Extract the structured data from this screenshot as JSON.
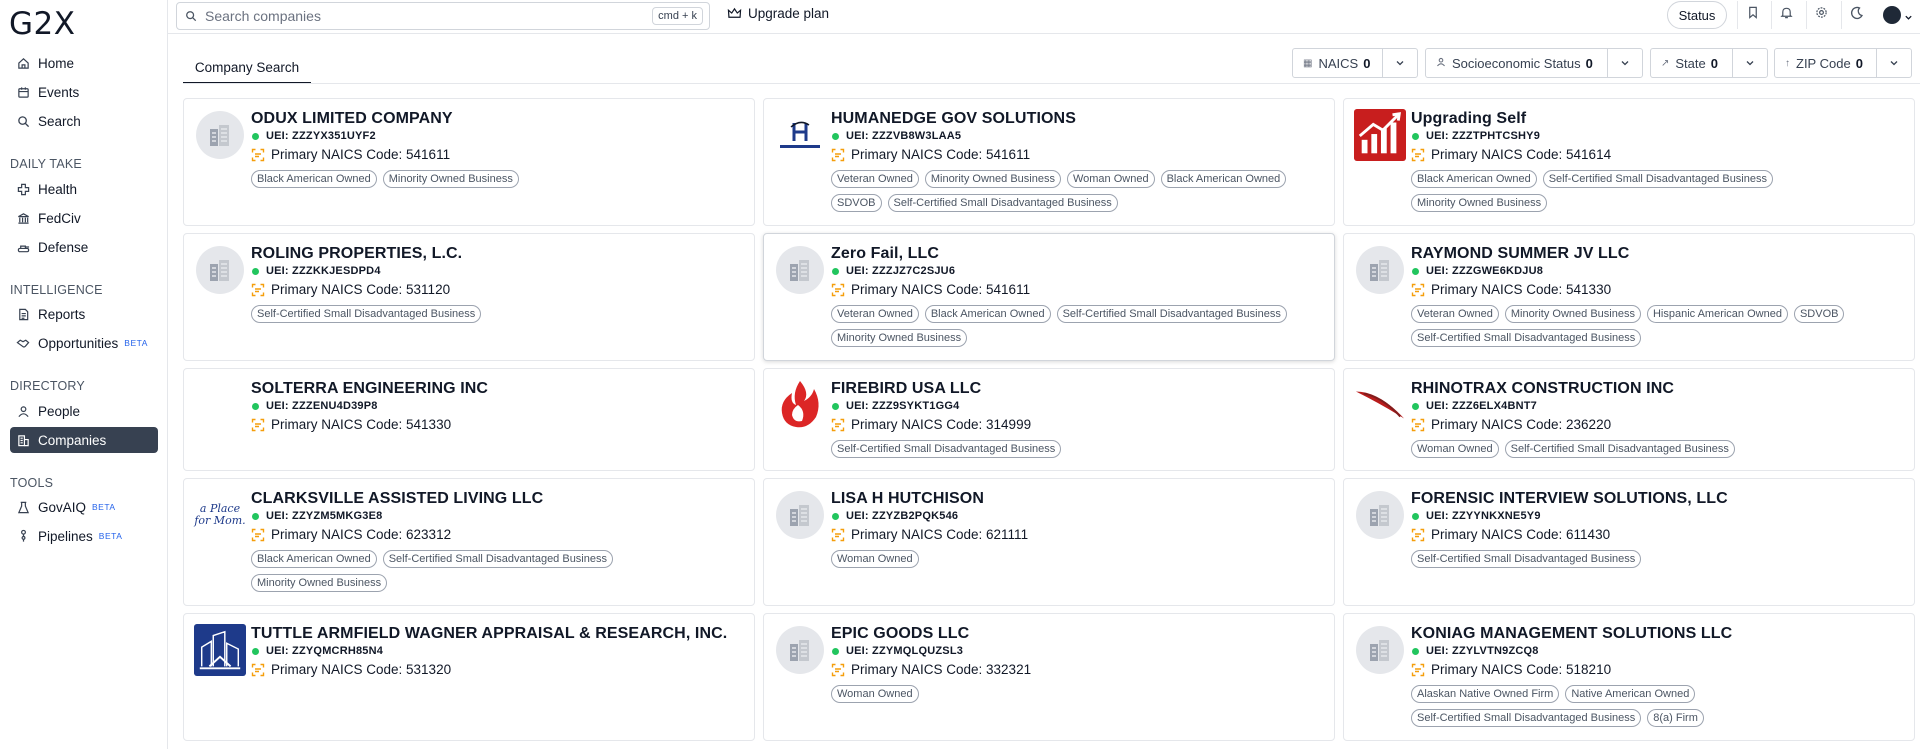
{
  "app": {
    "logo": "G2X"
  },
  "sidebar": {
    "items": [
      {
        "label": "Home",
        "icon": "home-icon"
      },
      {
        "label": "Events",
        "icon": "calendar-icon"
      },
      {
        "label": "Search",
        "icon": "search-icon"
      }
    ],
    "daily_take": {
      "title": "DAILY TAKE",
      "items": [
        {
          "label": "Health",
          "icon": "health-cross-icon"
        },
        {
          "label": "FedCiv",
          "icon": "bank-icon"
        },
        {
          "label": "Defense",
          "icon": "tank-icon"
        }
      ]
    },
    "intelligence": {
      "title": "INTELLIGENCE",
      "items": [
        {
          "label": "Reports",
          "icon": "document-icon"
        },
        {
          "label": "Opportunities",
          "icon": "handshake-icon",
          "badge": "BETA"
        }
      ]
    },
    "directory": {
      "title": "DIRECTORY",
      "items": [
        {
          "label": "People",
          "icon": "person-icon"
        },
        {
          "label": "Companies",
          "icon": "building-icon",
          "active": true
        }
      ]
    },
    "tools": {
      "title": "TOOLS",
      "items": [
        {
          "label": "GovAIQ",
          "icon": "flask-icon",
          "badge": "BETA"
        },
        {
          "label": "Pipelines",
          "icon": "pipeline-icon",
          "badge": "BETA"
        }
      ]
    }
  },
  "topbar": {
    "search_placeholder": "Search companies",
    "shortcut": "cmd + k",
    "upgrade_label": "Upgrade plan",
    "status_label": "Status"
  },
  "tabs": [
    {
      "label": "Company Search"
    }
  ],
  "filters": [
    {
      "label": "NAICS",
      "count": "0"
    },
    {
      "label": "Socioeconomic Status",
      "count": "0"
    },
    {
      "label": "State",
      "count": "0"
    },
    {
      "label": "ZIP Code",
      "count": "0"
    }
  ],
  "companies": [
    {
      "name": "ODUX LIMITED COMPANY",
      "uei": "UEI: ZZZYX351UYF2",
      "naics": "Primary NAICS Code: 541611",
      "logo": "placeholder",
      "tags": [
        "Black American Owned",
        "Minority Owned Business"
      ]
    },
    {
      "name": "HUMANEDGE GOV SOLUTIONS",
      "uei": "UEI: ZZZVB8W3LAA5",
      "naics": "Primary NAICS Code: 541611",
      "logo": "humanedge",
      "tags": [
        "Veteran Owned",
        "Minority Owned Business",
        "Woman Owned",
        "Black American Owned",
        "SDVOB",
        "Self-Certified Small Disadvantaged Business"
      ]
    },
    {
      "name": "Upgrading Self",
      "uei": "UEI: ZZZTPHTCSHY9",
      "naics": "Primary NAICS Code: 541614",
      "logo": "chart",
      "tags": [
        "Black American Owned",
        "Self-Certified Small Disadvantaged Business",
        "Minority Owned Business"
      ]
    },
    {
      "name": "ROLING PROPERTIES, L.C.",
      "uei": "UEI: ZZZKKJESDPD4",
      "naics": "Primary NAICS Code: 531120",
      "logo": "placeholder",
      "tags": [
        "Self-Certified Small Disadvantaged Business"
      ]
    },
    {
      "name": "Zero Fail, LLC",
      "uei": "UEI: ZZZJZ7C2SJU6",
      "naics": "Primary NAICS Code: 541611",
      "logo": "placeholder",
      "tags": [
        "Veteran Owned",
        "Black American Owned",
        "Self-Certified Small Disadvantaged Business",
        "Minority Owned Business"
      ],
      "highlight": true
    },
    {
      "name": "RAYMOND SUMMER JV LLC",
      "uei": "UEI: ZZZGWE6KDJU8",
      "naics": "Primary NAICS Code: 541330",
      "logo": "placeholder",
      "tags": [
        "Veteran Owned",
        "Minority Owned Business",
        "Hispanic American Owned",
        "SDVOB",
        "Self-Certified Small Disadvantaged Business"
      ]
    },
    {
      "name": "SOLTERRA ENGINEERING INC",
      "uei": "UEI: ZZZENU4D39P8",
      "naics": "Primary NAICS Code: 541330",
      "logo": "none",
      "tags": []
    },
    {
      "name": "FIREBIRD USA LLC",
      "uei": "UEI: ZZZ9SYKT1GG4",
      "naics": "Primary NAICS Code: 314999",
      "logo": "flame",
      "tags": [
        "Self-Certified Small Disadvantaged Business"
      ]
    },
    {
      "name": "RHINOTRAX CONSTRUCTION INC",
      "uei": "UEI: ZZZ6ELX4BNT7",
      "naics": "Primary NAICS Code: 236220",
      "logo": "swoosh",
      "tags": [
        "Woman Owned",
        "Self-Certified Small Disadvantaged Business"
      ]
    },
    {
      "name": "CLARKSVILLE ASSISTED LIVING LLC",
      "uei": "UEI: ZZYZM5MKG3E8",
      "naics": "Primary NAICS Code: 623312",
      "logo": "aplace",
      "logo_text": [
        "a Place",
        "for Mom."
      ],
      "tags": [
        "Black American Owned",
        "Self-Certified Small Disadvantaged Business",
        "Minority Owned Business"
      ]
    },
    {
      "name": "LISA H HUTCHISON",
      "uei": "UEI: ZZYZB2PQK546",
      "naics": "Primary NAICS Code: 621111",
      "logo": "placeholder",
      "tags": [
        "Woman Owned"
      ]
    },
    {
      "name": "FORENSIC INTERVIEW SOLUTIONS, LLC",
      "uei": "UEI: ZZYYNKXNE5Y9",
      "naics": "Primary NAICS Code: 611430",
      "logo": "placeholder",
      "tags": [
        "Self-Certified Small Disadvantaged Business"
      ]
    },
    {
      "name": "TUTTLE ARMFIELD WAGNER APPRAISAL & RESEARCH, INC.",
      "uei": "UEI: ZZYQMCRH85N4",
      "naics": "Primary NAICS Code: 531320",
      "logo": "buildings",
      "tags": []
    },
    {
      "name": "EPIC GOODS LLC",
      "uei": "UEI: ZZYMQLQUZSL3",
      "naics": "Primary NAICS Code: 332321",
      "logo": "placeholder",
      "tags": [
        "Woman Owned"
      ]
    },
    {
      "name": "KONIAG MANAGEMENT SOLUTIONS LLC",
      "uei": "UEI: ZZYLVTN9ZCQ8",
      "naics": "Primary NAICS Code: 518210",
      "logo": "placeholder",
      "tags": [
        "Alaskan Native Owned Firm",
        "Native American Owned",
        "Self-Certified Small Disadvantaged Business",
        "8(a) Firm"
      ]
    }
  ],
  "colors": {
    "active_nav": "#374151",
    "uei_dot": "#22c55e",
    "naics_icon": "#f59e0b",
    "beta": "#2563eb"
  }
}
